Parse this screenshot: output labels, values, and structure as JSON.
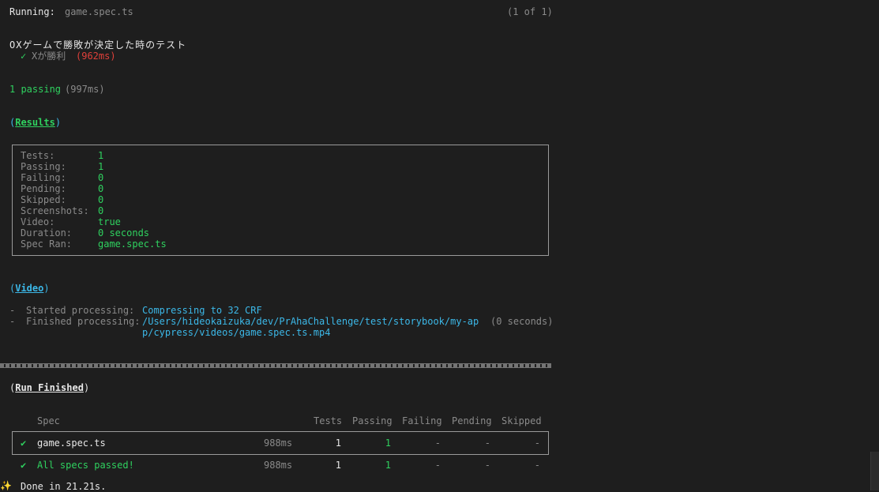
{
  "header": {
    "running_label": "Running:",
    "running_file": "game.spec.ts",
    "counter": "(1 of 1)"
  },
  "suite": {
    "title": "OXゲームで勝敗が決定した時のテスト",
    "test_check": "✓",
    "test_name": "Xが勝利",
    "test_time": "(962ms)"
  },
  "passing": {
    "text": "1 passing",
    "time": "(997ms)"
  },
  "results": {
    "heading_open": "(",
    "heading": "Results",
    "heading_close": ")",
    "rows": [
      {
        "label": "Tests:",
        "value": "1"
      },
      {
        "label": "Passing:",
        "value": "1"
      },
      {
        "label": "Failing:",
        "value": "0"
      },
      {
        "label": "Pending:",
        "value": "0"
      },
      {
        "label": "Skipped:",
        "value": "0"
      },
      {
        "label": "Screenshots:",
        "value": "0"
      },
      {
        "label": "Video:",
        "value": "true"
      },
      {
        "label": "Duration:",
        "value": "0 seconds"
      },
      {
        "label": "Spec Ran:",
        "value": "game.spec.ts"
      }
    ]
  },
  "video": {
    "heading_open": "(",
    "heading": "Video",
    "heading_close": ")",
    "dash": "-",
    "started_label": "Started processing:",
    "started_value": "Compressing to 32 CRF",
    "finished_label": "Finished processing:",
    "finished_value_1": "/Users/hideokaizuka/dev/PrAhaChallenge/test/storybook/my-ap",
    "finished_value_2": "p/cypress/videos/game.spec.ts.mp4",
    "finished_time": "(0 seconds)"
  },
  "run_finished": {
    "heading_open": "(",
    "heading": "Run Finished",
    "heading_close": ")",
    "columns": [
      "Spec",
      "Tests",
      "Passing",
      "Failing",
      "Pending",
      "Skipped"
    ],
    "rows": [
      {
        "check": "✔",
        "spec": "game.spec.ts",
        "time": "988ms",
        "tests": "1",
        "passing": "1",
        "failing": "-",
        "pending": "-",
        "skipped": "-"
      },
      {
        "check": "✔",
        "spec": "All specs passed!",
        "time": "988ms",
        "tests": "1",
        "passing": "1",
        "failing": "-",
        "pending": "-",
        "skipped": "-"
      }
    ]
  },
  "done": {
    "sparkle": "✨",
    "text": "Done in 21.21s."
  }
}
